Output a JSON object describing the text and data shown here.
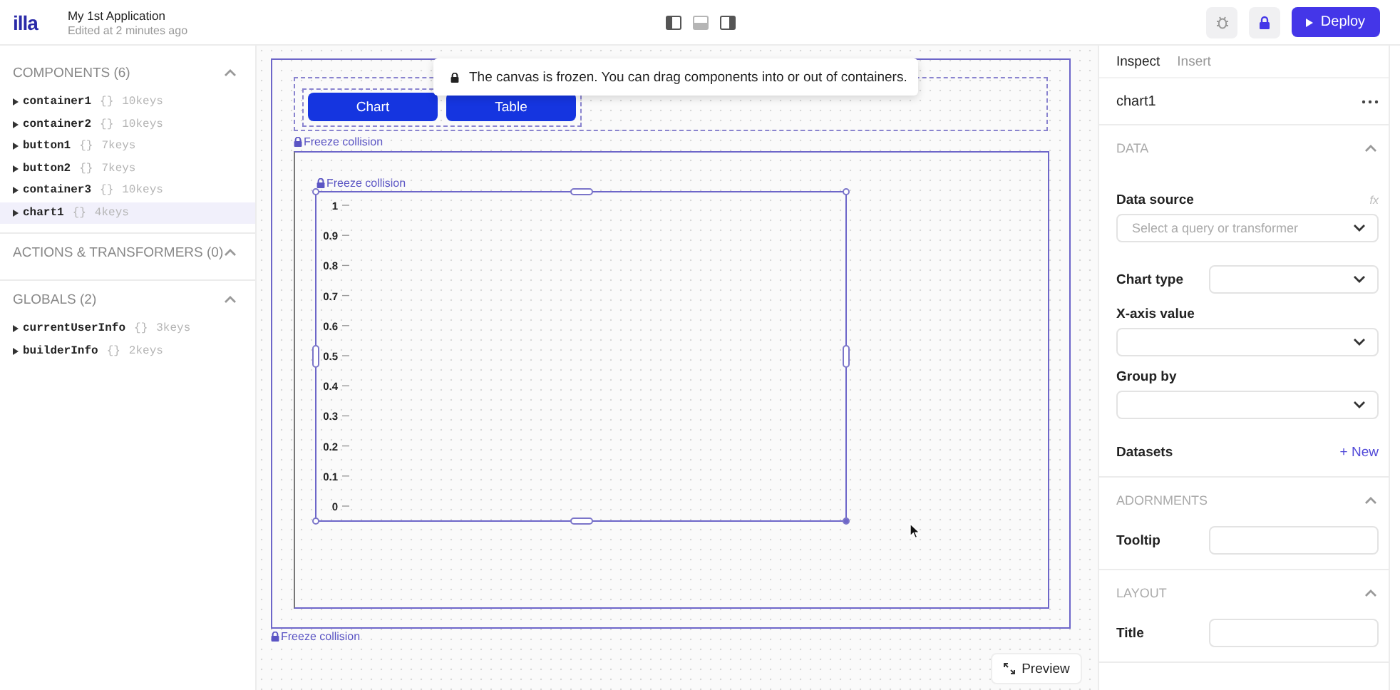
{
  "topbar": {
    "logo": "illa",
    "app_name": "My 1st Application",
    "edited": "Edited at 2 minutes ago",
    "panels": [
      {
        "kind": "left",
        "on": true
      },
      {
        "kind": "bottom",
        "on": false
      },
      {
        "kind": "right",
        "on": true
      }
    ],
    "deploy": "Deploy"
  },
  "sidebar": {
    "sections": [
      {
        "title": "COMPONENTS (6)",
        "expanded": true,
        "items": [
          {
            "name": "container1",
            "braces": "{}",
            "keys": "10keys",
            "selected": false
          },
          {
            "name": "container2",
            "braces": "{}",
            "keys": "10keys",
            "selected": false
          },
          {
            "name": "button1",
            "braces": "{}",
            "keys": "7keys",
            "selected": false
          },
          {
            "name": "button2",
            "braces": "{}",
            "keys": "7keys",
            "selected": false
          },
          {
            "name": "container3",
            "braces": "{}",
            "keys": "10keys",
            "selected": false
          },
          {
            "name": "chart1",
            "braces": "{}",
            "keys": "4keys",
            "selected": true
          }
        ]
      },
      {
        "title": "ACTIONS & TRANSFORMERS (0)",
        "expanded": true
      },
      {
        "title": "GLOBALS (2)",
        "expanded": true,
        "items": [
          {
            "name": "currentUserInfo",
            "braces": "{}",
            "keys": "3keys",
            "selected": false
          },
          {
            "name": "builderInfo",
            "braces": "{}",
            "keys": "2keys",
            "selected": false
          }
        ]
      }
    ]
  },
  "canvas": {
    "notice": "The canvas is frozen. You can drag components into or out of containers.",
    "buttons": [
      "Chart",
      "Table"
    ],
    "freeze_labels": [
      "Freeze collision",
      "Freeze collision",
      "Freeze collision"
    ],
    "chart": {
      "y_axis_labels": [
        "1",
        "0.9",
        "0.8",
        "0.7",
        "0.6",
        "0.5",
        "0.4",
        "0.3",
        "0.2",
        "0.1",
        "0"
      ]
    },
    "preview": "Preview"
  },
  "inspector": {
    "tabs": [
      {
        "label": "Inspect",
        "selected": true
      },
      {
        "label": "Insert",
        "selected": false
      }
    ],
    "component": "chart1",
    "sections": [
      {
        "title": "DATA",
        "expanded": true,
        "fields": [
          {
            "kind": "select",
            "label": "Data source",
            "hint": "fx",
            "placeholder": "Select a query or transformer"
          },
          {
            "kind": "inline-select",
            "label": "Chart type"
          },
          {
            "kind": "select",
            "label": "X-axis value"
          },
          {
            "kind": "select",
            "label": "Group by"
          },
          {
            "kind": "add",
            "label": "Datasets",
            "action": "+ New"
          }
        ]
      },
      {
        "title": "ADORNMENTS",
        "expanded": true,
        "fields": [
          {
            "kind": "inline-input",
            "label": "Tooltip"
          }
        ]
      },
      {
        "title": "LAYOUT",
        "expanded": true,
        "fields": [
          {
            "kind": "inline-input",
            "label": "Title"
          }
        ]
      }
    ]
  }
}
